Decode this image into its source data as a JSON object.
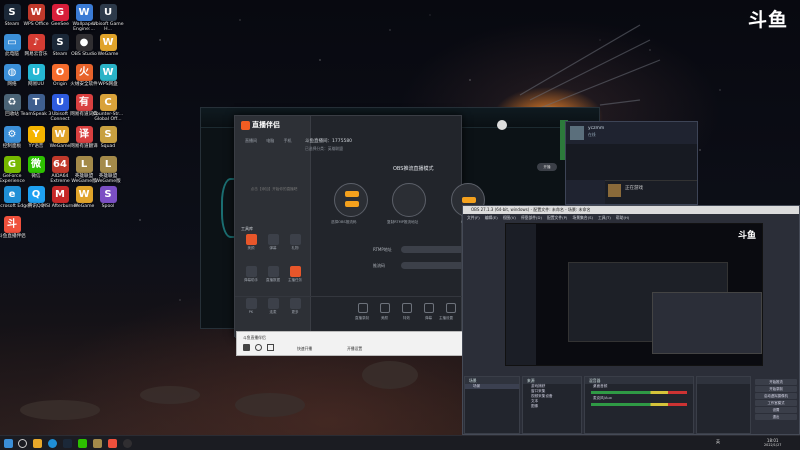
{
  "desktop_icons": [
    {
      "label": "Steam",
      "icon": "steam-icon",
      "color": "#1b2838",
      "glyph": "S"
    },
    {
      "label": "WPS Office",
      "icon": "wps-icon",
      "color": "#c0392b",
      "glyph": "W"
    },
    {
      "label": "GeeSee",
      "icon": "geesee-icon",
      "color": "#d81e3a",
      "glyph": "G"
    },
    {
      "label": "Wallpaper Engine:...",
      "icon": "wallpaper-engine-icon",
      "color": "#3a7bd5",
      "glyph": "W"
    },
    {
      "label": "Ubisoft Game H...",
      "icon": "ubisoft-icon",
      "color": "#2d3a4a",
      "glyph": "U"
    },
    {
      "label": "此电脑",
      "icon": "computer-icon",
      "color": "#3b8fd8",
      "glyph": "▭"
    },
    {
      "label": "网易云音乐",
      "icon": "netease-music-icon",
      "color": "#d43c33",
      "glyph": "♪"
    },
    {
      "label": "Steam",
      "icon": "steam-icon",
      "color": "#1b2838",
      "glyph": "S"
    },
    {
      "label": "OBS Studio",
      "icon": "obs-icon",
      "color": "#302e31",
      "glyph": "●"
    },
    {
      "label": "WeGame",
      "icon": "wegame-icon",
      "color": "#e0a32a",
      "glyph": "W"
    },
    {
      "label": "网络",
      "icon": "network-icon",
      "color": "#3b8fd8",
      "glyph": "◍"
    },
    {
      "label": "网易UU",
      "icon": "uu-booster-icon",
      "color": "#25b7d3",
      "glyph": "U"
    },
    {
      "label": "Origin",
      "icon": "origin-icon",
      "color": "#f56c2d",
      "glyph": "O"
    },
    {
      "label": "火绒安全软件",
      "icon": "huorong-icon",
      "color": "#e8632b",
      "glyph": "火"
    },
    {
      "label": "WPS网盘",
      "icon": "wps-cloud-icon",
      "color": "#2ab3c7",
      "glyph": "W"
    },
    {
      "label": "回收站",
      "icon": "recycle-bin-icon",
      "color": "#4b6477",
      "glyph": "♻"
    },
    {
      "label": "TeamSpeak 3",
      "icon": "teamspeak-icon",
      "color": "#3f5f8f",
      "glyph": "T"
    },
    {
      "label": "Ubisoft Connect",
      "icon": "ubisoft-connect-icon",
      "color": "#2e5bde",
      "glyph": "U"
    },
    {
      "label": "网易有道词典",
      "icon": "youdao-icon",
      "color": "#d94040",
      "glyph": "有"
    },
    {
      "label": "Counter-Str... Global Off...",
      "icon": "csgo-icon",
      "color": "#d9a23a",
      "glyph": "C"
    },
    {
      "label": "控制面板",
      "icon": "control-panel-icon",
      "color": "#3b8fd8",
      "glyph": "⚙"
    },
    {
      "label": "YY语音",
      "icon": "yy-icon",
      "color": "#f5b400",
      "glyph": "Y"
    },
    {
      "label": "WeGame",
      "icon": "wegame-icon",
      "color": "#e0a32a",
      "glyph": "W"
    },
    {
      "label": "网易有道翻译",
      "icon": "youdao-translate-icon",
      "color": "#d94040",
      "glyph": "译"
    },
    {
      "label": "Squad",
      "icon": "squad-icon",
      "color": "#c8a040",
      "glyph": "S"
    },
    {
      "label": "GeForce Experience",
      "icon": "geforce-icon",
      "color": "#76b900",
      "glyph": "G"
    },
    {
      "label": "微信",
      "icon": "wechat-icon",
      "color": "#2dc100",
      "glyph": "微"
    },
    {
      "label": "AIDA64 Extreme",
      "icon": "aida64-icon",
      "color": "#c0392b",
      "glyph": "64"
    },
    {
      "label": "英雄联盟WeGame版",
      "icon": "lol-icon",
      "color": "#a48a4a",
      "glyph": "L"
    },
    {
      "label": "英雄联盟WeGame版",
      "icon": "lol-icon",
      "color": "#a48a4a",
      "glyph": "L"
    },
    {
      "label": "Microsoft Edge",
      "icon": "edge-icon",
      "color": "#1f8fd6",
      "glyph": "e"
    },
    {
      "label": "腾讯QQ",
      "icon": "qq-icon",
      "color": "#1ea0f1",
      "glyph": "Q"
    },
    {
      "label": "MSI Afterburner",
      "icon": "msi-afterburner-icon",
      "color": "#c62828",
      "glyph": "M"
    },
    {
      "label": "WeGame",
      "icon": "wegame-icon",
      "color": "#e0a32a",
      "glyph": "W"
    },
    {
      "label": "Spool",
      "icon": "spool-icon",
      "color": "#7b4fc4",
      "glyph": "S"
    },
    {
      "label": "斗鱼直播伴侣",
      "icon": "douyu-companion-icon",
      "color": "#f0503c",
      "glyph": "斗"
    }
  ],
  "watermark": {
    "text": "斗鱼"
  },
  "douyu_window": {
    "brand": "直播伴侣",
    "tabs": [
      "直播间",
      "电脑",
      "手机"
    ],
    "empty_hint": "点击【添加】开始你的直播吧",
    "tools_header": "工具库",
    "tools": [
      "美颜",
      "弹幕",
      "礼物",
      "弹幕助手",
      "直播数据",
      "主播任务",
      "PK",
      "连麦",
      "更多"
    ],
    "room_title": "斗鱼直播间：1775580",
    "room_sub": "已选择分类：英雄联盟",
    "mode_title": "OBS推流直播模式",
    "start_button": "开播",
    "mode_labels": [
      "选择OBS推流码",
      "复制RTMP推流地址",
      "OBS"
    ],
    "field_labels": [
      "RTMP地址",
      "推流码"
    ],
    "bottom_labels": [
      "直播录制",
      "美颜",
      "特效",
      "弹幕",
      "主播设置"
    ],
    "bar_texts": [
      "斗鱼直播伴侣",
      "快速开播",
      "开播设置"
    ]
  },
  "steam_chat": {
    "name": "yczmm",
    "status": "在线",
    "game_label": "正在游戏"
  },
  "obs": {
    "title": "OBS 27.1.3 (64-bit, windows) - 配置文件: 未命名 - 场景: 未命名",
    "menu": [
      "文件(F)",
      "编辑(E)",
      "视图(V)",
      "停靠部件(D)",
      "配置文件(P)",
      "场景集合(S)",
      "工具(T)",
      "帮助(H)"
    ],
    "scenes_title": "场景",
    "scenes": [
      "场景"
    ],
    "sources_title": "来源",
    "sources": [
      "游戏捕获",
      "窗口采集",
      "视频采集设备",
      "文本",
      "图像"
    ],
    "mixer_title": "混音器",
    "mixer": [
      "桌面音频",
      "麦克风/Aux"
    ],
    "controls": [
      "开始推流",
      "开始录制",
      "启动虚拟摄像机",
      "工作室模式",
      "设置",
      "退出"
    ],
    "status": "LIVE: 00:00:00  REC: 00:00:00  CPU: 2.0%, 60.00 fps"
  },
  "taskbar": {
    "time": "18:01",
    "date": "2022/1/27",
    "lang": "英"
  }
}
